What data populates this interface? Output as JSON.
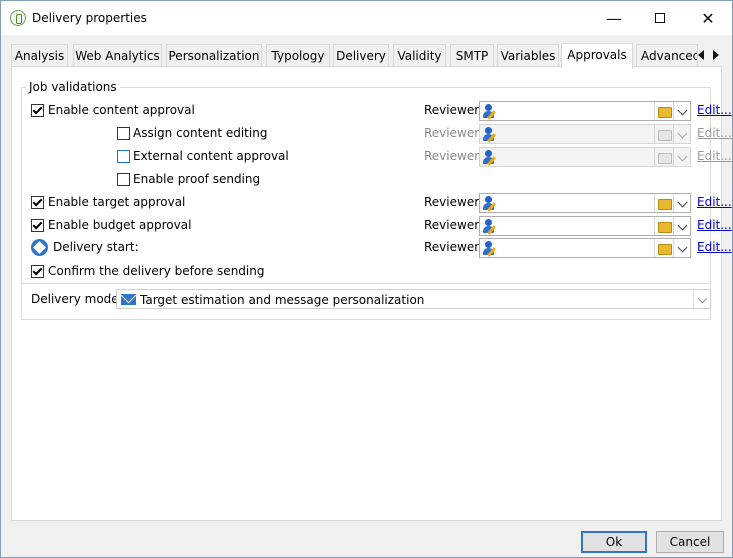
{
  "window": {
    "title": "Delivery properties"
  },
  "tabs": [
    {
      "label": "Analysis"
    },
    {
      "label": "Web Analytics"
    },
    {
      "label": "Personalization"
    },
    {
      "label": "Typology"
    },
    {
      "label": "Delivery"
    },
    {
      "label": "Validity"
    },
    {
      "label": "SMTP"
    },
    {
      "label": "Variables"
    },
    {
      "label": "Approvals",
      "active": true
    },
    {
      "label": "Advanced"
    }
  ],
  "job_validations": {
    "legend": "Job validations",
    "rows": [
      {
        "label": "Enable content approval",
        "checked": true,
        "reviewer_label": "Reviewer:",
        "reviewer_value": "",
        "edit_label": "Edit...",
        "enabled": true
      },
      {
        "label": "Assign content editing",
        "checked": false,
        "reviewer_label": "Reviewer:",
        "reviewer_value": "",
        "edit_label": "Edit...",
        "enabled": false
      },
      {
        "label": "External content approval",
        "checked": false,
        "reviewer_label": "Reviewer:",
        "reviewer_value": "",
        "edit_label": "Edit...",
        "enabled": false
      },
      {
        "label": "Enable proof sending",
        "checked": false
      },
      {
        "label": "Enable target approval",
        "checked": true,
        "reviewer_label": "Reviewer:",
        "reviewer_value": "",
        "edit_label": "Edit...",
        "enabled": true
      },
      {
        "label": "Enable budget approval",
        "checked": true,
        "reviewer_label": "Reviewer:",
        "reviewer_value": "",
        "edit_label": "Edit...",
        "enabled": true
      },
      {
        "label": "Delivery start:",
        "reviewer_label": "Reviewer:",
        "reviewer_value": "",
        "edit_label": "Edit...",
        "enabled": true
      },
      {
        "label": "Confirm the delivery before sending",
        "checked": true
      }
    ],
    "delivery_mode": {
      "label": "Delivery mode:",
      "value": "Target estimation and message personalization"
    }
  },
  "buttons": {
    "ok": "Ok",
    "cancel": "Cancel"
  },
  "colors": {
    "accent": "#2f76c9",
    "link": "#0000cc"
  }
}
